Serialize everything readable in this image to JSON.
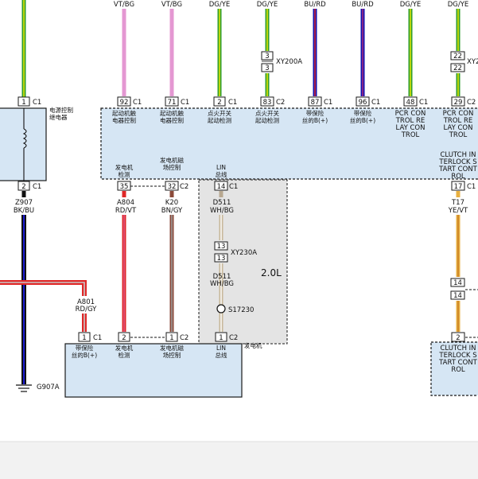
{
  "wire_codes": {
    "vt_bg_1": "VT/BG",
    "vt_bg_2": "VT/BG",
    "dg_ye_1": "DG/YE",
    "dg_ye_2": "DG/YE",
    "bu_rd_1": "BU/RD",
    "bu_rd_2": "BU/RD",
    "dg_ye_3": "DG/YE",
    "dg_ye_4": "DG/YE"
  },
  "inline_connectors": {
    "xy200a_pin_top": "3",
    "xy200a_pin_bottom": "3",
    "xy200a_label": "XY200A",
    "xy2_pin_top": "22",
    "xy2_pin_bottom": "22",
    "xy2_label": "XY2",
    "xy230a_pin_top": "13",
    "xy230a_pin_bottom": "13",
    "xy230a_label": "XY230A",
    "c14_pin_top": "14",
    "c14_pin_bottom": "14"
  },
  "pins": {
    "p1": "1",
    "p92": "92",
    "p71": "71",
    "p2": "2",
    "p83": "83",
    "p87": "87",
    "p96": "96",
    "p48": "48",
    "p29": "29",
    "p2b": "2",
    "p35": "35",
    "p32": "32",
    "p14": "14",
    "p17": "17",
    "p1b": "1",
    "p2c": "2",
    "p1c": "1",
    "p1d": "1",
    "p2d": "2"
  },
  "connector_ids": {
    "c1_a": "C1",
    "c1_b": "C1",
    "c1_c": "C1",
    "c1_d": "C1",
    "c2_a": "C2",
    "c1_e": "C1",
    "c1_f": "C1",
    "c1_g": "C1",
    "c2_b": "C2",
    "c1_h": "C1",
    "c2_c": "C2",
    "c1_i": "C1",
    "c1_j": "C1",
    "c1_k": "C1",
    "c2_d": "C2",
    "c2_e": "C2"
  },
  "relay": {
    "label_line1": "电源控制",
    "label_line2": "继电器"
  },
  "ecm_top_labels": {
    "l92_1": "起动机触",
    "l92_2": "电器控制",
    "l71_1": "起动机触",
    "l71_2": "电器控制",
    "l2_1": "点火开关",
    "l2_2": "起动检测",
    "l83_1": "点火开关",
    "l83_2": "起动检测",
    "l87_1": "带保险",
    "l87_2": "丝的B(+)",
    "l96_1": "带保险",
    "l96_2": "丝的B(+)",
    "l48_1": "PCR CON",
    "l48_2": "TROL RE",
    "l48_3": "LAY CON",
    "l48_4": "TROL",
    "l29_1": "PCR CON",
    "l29_2": "TROL RE",
    "l29_3": "LAY CON",
    "l29_4": "TROL"
  },
  "ecm_bottom_labels": {
    "l35_1": "发电机",
    "l35_2": "检测",
    "l32_1": "发电机磁",
    "l32_2": "场控制",
    "l14_1": "LIN",
    "l14_2": "总线",
    "l17_1": "CLUTCH IN",
    "l17_2": "TERLOCK S",
    "l17_3": "TART CONT",
    "l17_4": "ROL"
  },
  "wires": {
    "z907": "Z907",
    "z907_color": "BK/BU",
    "a804": "A804",
    "a804_color": "RD/VT",
    "k20": "K20",
    "k20_color": "BN/GY",
    "d511_a": "D511",
    "d511_a_color": "WH/BG",
    "d511_b": "D511",
    "d511_b_color": "WH/BG",
    "t17": "T17",
    "t17_color": "YE/VT",
    "a801": "A801",
    "a801_color": "RD/GY"
  },
  "splice": {
    "label": "S17230"
  },
  "engine_variant": "2.0L",
  "generator": {
    "title": "发电机",
    "pin1_l1": "带保险",
    "pin1_l2": "丝的B(+)",
    "pin2_l1": "发电机",
    "pin2_l2": "检测",
    "pin3_l1": "发电机磁",
    "pin3_l2": "场控制",
    "pin4_l1": "LIN",
    "pin4_l2": "总线"
  },
  "ground": {
    "label": "G907A"
  },
  "right_module": {
    "l1": "CLUTCH IN",
    "l2": "TERLOCK S",
    "l3": "TART CONT",
    "l4": "ROL"
  },
  "colors": {
    "box_fill": "#d6e6f4",
    "wire_green": "#2e9c2e",
    "wire_yellow": "#e8e800",
    "wire_pink": "#e497d2",
    "wire_blue": "#1212b0",
    "wire_purple": "#7a1f9a",
    "wire_red": "#e02828",
    "wire_brown": "#8b4a3a",
    "wire_orange_yellow": "#e8b040",
    "wire_black": "#111111",
    "gray_zone": "#e4e4e4"
  }
}
